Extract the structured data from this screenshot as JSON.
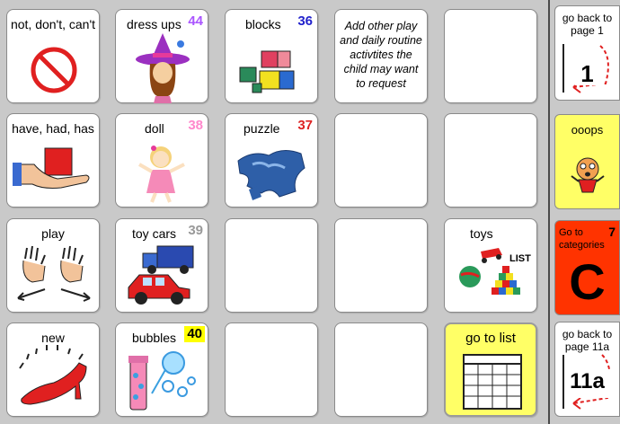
{
  "colors": {
    "background": "#c9c9c9",
    "cell": "#ffffff",
    "yellow": "#ffff66",
    "category": "#ff3300",
    "num_purple": "#aa55ff",
    "num_blue": "#2222cc",
    "num_pink": "#ff88cc",
    "num_red": "#dd2222",
    "num_gray": "#999999"
  },
  "grid": {
    "r1": {
      "c1": {
        "label": "not, don't, can't",
        "icon": "no-sign-icon"
      },
      "c2": {
        "label": "dress ups",
        "number": "44",
        "icon": "witch-costume-icon"
      },
      "c3": {
        "label": "blocks",
        "number": "36",
        "icon": "blocks-icon"
      },
      "c4": {
        "note": "Add other play and daily routine activtites the child may want to request"
      },
      "c5": {}
    },
    "r2": {
      "c1": {
        "label": "have, had, has",
        "icon": "hand-holding-icon"
      },
      "c2": {
        "label": "doll",
        "number": "38",
        "icon": "doll-icon"
      },
      "c3": {
        "label": "puzzle",
        "number": "37",
        "icon": "puzzle-icon"
      },
      "c4": {},
      "c5": {}
    },
    "r3": {
      "c1": {
        "label": "play",
        "icon": "play-sign-icon"
      },
      "c2": {
        "label": "toy cars",
        "number": "39",
        "icon": "toy-cars-icon"
      },
      "c3": {},
      "c4": {},
      "c5": {
        "label": "toys",
        "list_text": "LIST",
        "icon": "toys-list-icon"
      }
    },
    "r4": {
      "c1": {
        "label": "new",
        "icon": "shoe-icon"
      },
      "c2": {
        "label": "bubbles",
        "number": "40",
        "icon": "bubbles-icon"
      },
      "c3": {},
      "c4": {},
      "c5": {
        "label": "go to list",
        "icon": "list-grid-icon"
      }
    }
  },
  "sidebar": {
    "back1": {
      "label": "go back to page 1",
      "page": "1",
      "icon": "return-arrow-icon"
    },
    "ooops": {
      "label": "ooops",
      "icon": "ooops-face-icon"
    },
    "categories": {
      "label": "Go to categories",
      "number": "7",
      "letter": "C"
    },
    "back11a": {
      "label": "go back to page 11a",
      "page": "11a",
      "icon": "return-arrow-icon"
    }
  }
}
